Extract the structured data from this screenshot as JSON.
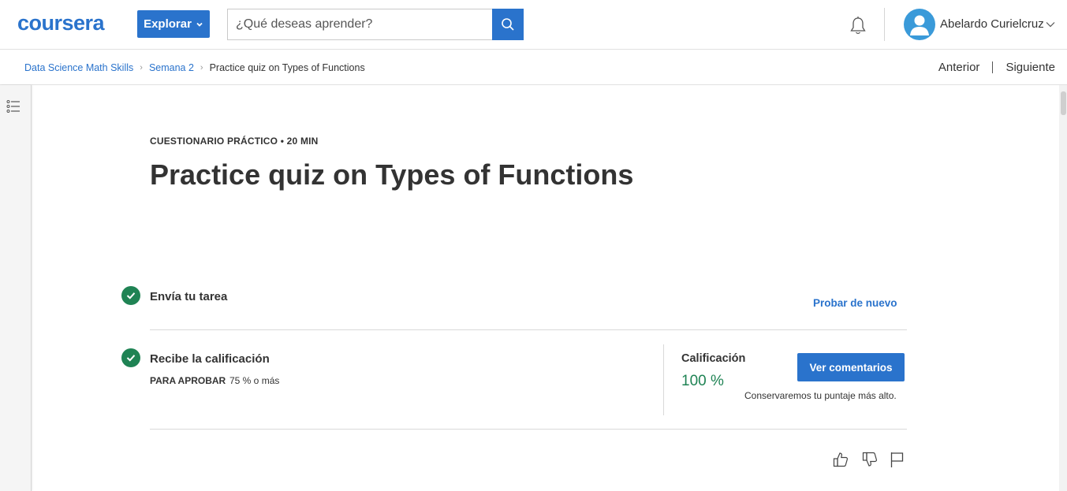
{
  "header": {
    "logo_text": "coursera",
    "explore_label": "Explorar",
    "search_placeholder": "¿Qué deseas aprender?",
    "user_name": "Abelardo Curielcruz",
    "brand_color": "#2a73cc"
  },
  "breadcrumb": {
    "items": [
      "Data Science Math Skills",
      "Semana 2"
    ],
    "current": "Practice quiz on Types of Functions",
    "prev_label": "Anterior",
    "next_label": "Siguiente"
  },
  "main": {
    "kicker": "CUESTIONARIO PRÁCTICO • 20 MIN",
    "title": "Practice quiz on Types of Functions",
    "step1": {
      "title": "Envía tu tarea",
      "action_label": "Probar de nuevo"
    },
    "step2": {
      "title": "Recibe la calificación",
      "pass_label": "PARA APROBAR",
      "pass_value": "75 % o más"
    },
    "grade": {
      "label": "Calificación",
      "value": "100 %",
      "button_label": "Ver comentarios",
      "note": "Conservaremos tu puntaje más alto."
    },
    "success_color": "#1f8354"
  },
  "icons": [
    "search-icon",
    "bell-icon",
    "user-avatar-icon",
    "chevron-down-icon",
    "outline-list-icon",
    "check-icon",
    "thumbs-up-icon",
    "thumbs-down-icon",
    "flag-icon"
  ]
}
